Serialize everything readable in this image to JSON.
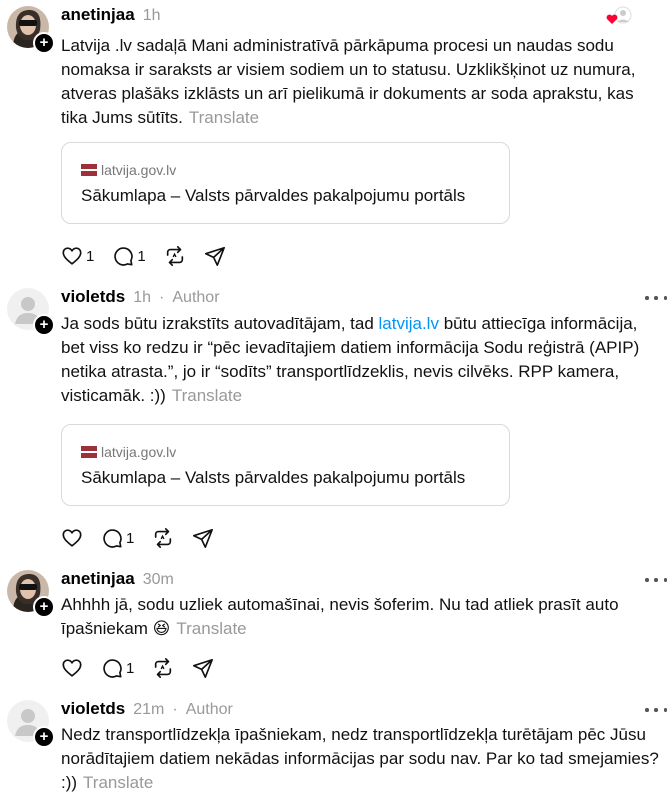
{
  "posts": [
    {
      "username": "anetinjaa",
      "time": "1h",
      "author_tag": "",
      "text": "Latvija .lv sadaļā Mani administratīvā pārkāpuma procesi un naudas sodu nomaksa ir saraksts ar visiem sodiem un to statusu. Uzklikšķinot uz numura, atveras plašāks izklāsts un arī pielikumā ir dokuments ar soda aprakstu, kas tika Jums sūtīts.",
      "translate": "Translate",
      "card": {
        "domain": "latvija.gov.lv",
        "title": "Sākumlapa – Valsts pārvaldes pakalpojumu portāls"
      },
      "likes": "1",
      "replies": "1"
    },
    {
      "username": "violetds",
      "time": "1h",
      "author_tag": "Author",
      "text_before_link": "Ja sods būtu izrakstīts autovadītājam, tad ",
      "link": "latvija.lv",
      "text_after_link": " būtu attiecīga informācija, bet viss ko redzu ir “pēc ievadītajiem datiem informācija Sodu reģistrā (APIP) netika atrasta.”, jo ir “sodīts” transportlīdzeklis, nevis cilvēks. RPP kamera, visticamāk. :))",
      "translate": "Translate",
      "card": {
        "domain": "latvija.gov.lv",
        "title": "Sākumlapa – Valsts pārvaldes pakalpojumu portāls"
      },
      "likes": "",
      "replies": "1"
    },
    {
      "username": "anetinjaa",
      "time": "30m",
      "author_tag": "",
      "text": "Ahhhh jā, sodu uzliek automašīnai, nevis šoferim. Nu tad atliek prasīt auto īpašniekam 😆",
      "translate": "Translate",
      "likes": "",
      "replies": "1"
    },
    {
      "username": "violetds",
      "time": "21m",
      "author_tag": "Author",
      "text": "Nedz transportlīdzekļa īpašniekam, nedz transportlīdzekļa turētājam pēc Jūsu norādītajiem datiem nekādas informācijas par sodu nav. Par ko tad smejamies? :))",
      "translate": "Translate"
    }
  ],
  "icons": {
    "like": "heart-icon",
    "reply": "comment-icon",
    "repost": "repost-icon",
    "share": "send-icon",
    "more": "more-icon"
  },
  "colors": {
    "link": "#0095f6",
    "muted": "#999999",
    "like_badge": "#ff0034",
    "flag_red": "#9e3039"
  }
}
